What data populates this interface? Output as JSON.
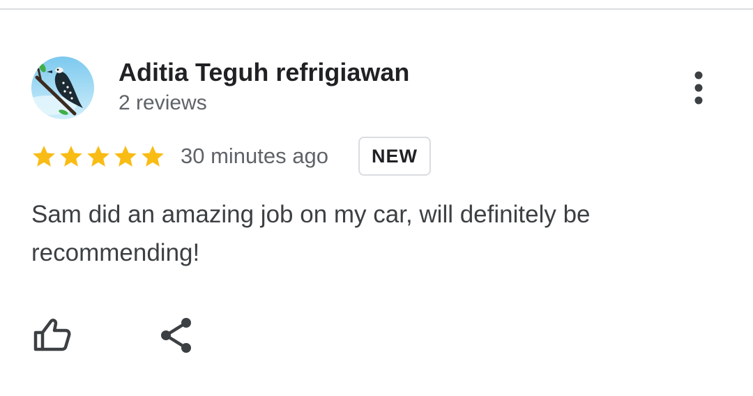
{
  "review": {
    "author": {
      "name": "Aditia Teguh refrigiawan",
      "review_count": "2 reviews",
      "avatar_icon": "kingfisher-bird-avatar"
    },
    "rating": 5,
    "rating_max": 5,
    "time": "30 minutes ago",
    "badge": "NEW",
    "text": "Sam did an amazing job on my car, will definitely be recommending!"
  },
  "actions": {
    "more_icon": "more-vertical-icon",
    "like_icon": "thumbs-up-icon",
    "share_icon": "share-icon"
  },
  "colors": {
    "star": "#f9bc15",
    "text_primary": "#202124",
    "text_secondary": "#5f6368",
    "icon": "#3c4043",
    "divider": "#dadce0"
  }
}
